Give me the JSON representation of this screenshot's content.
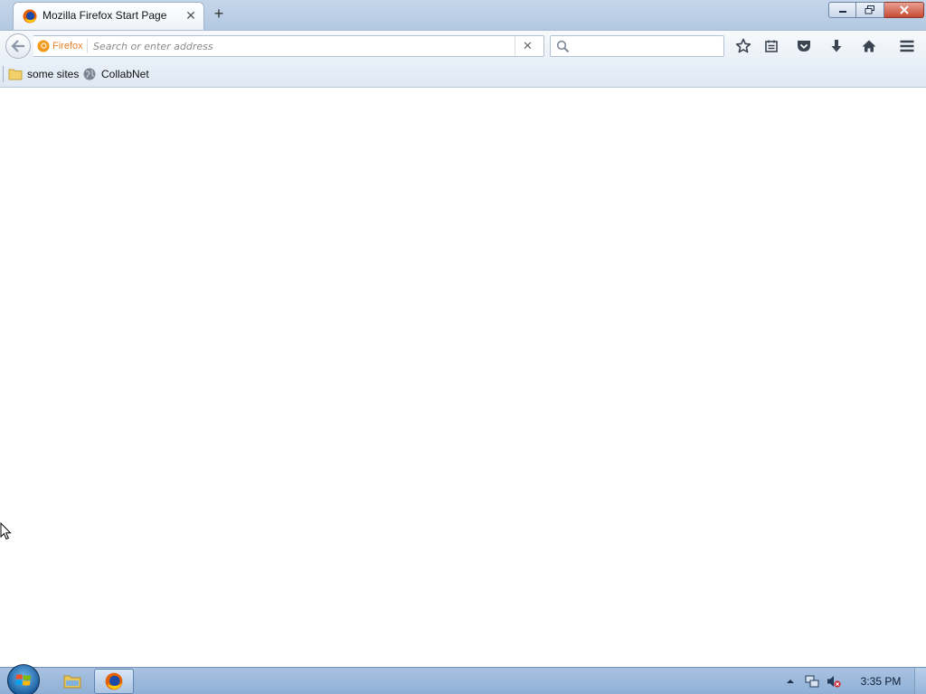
{
  "window": {
    "tab": {
      "title": "Mozilla Firefox Start Page",
      "favicon": "firefox-icon",
      "close_glyph": "✕"
    },
    "new_tab_glyph": "+",
    "controls": [
      "minimize-icon",
      "restore-icon",
      "close-icon"
    ]
  },
  "navbar": {
    "identity_label": "Firefox",
    "url_value": "",
    "url_placeholder": "Search or enter address",
    "clear_glyph": "✕",
    "search_value": "",
    "toolbar_icons": [
      "bookmark-star-icon",
      "reading-list-icon",
      "pocket-icon",
      "downloads-icon",
      "home-icon",
      "menu-icon"
    ]
  },
  "bookmarks": {
    "items": [
      {
        "label": "some sites",
        "icon": "folder-icon"
      },
      {
        "label": "CollabNet",
        "icon": "globe-icon"
      }
    ]
  },
  "taskbar": {
    "start": "windows-start-icon",
    "pinned": [
      "file-explorer-icon",
      "firefox-icon"
    ],
    "active_app": "firefox",
    "tray_icons": [
      "tray-expand-icon",
      "network-icon",
      "volume-muted-icon"
    ],
    "clock": "3:35 PM"
  },
  "colors": {
    "titlebar": "#b3c8e2",
    "close_button": "#c84a33",
    "identity_orange": "#e4802a",
    "taskbar": "#8fb0d6"
  }
}
